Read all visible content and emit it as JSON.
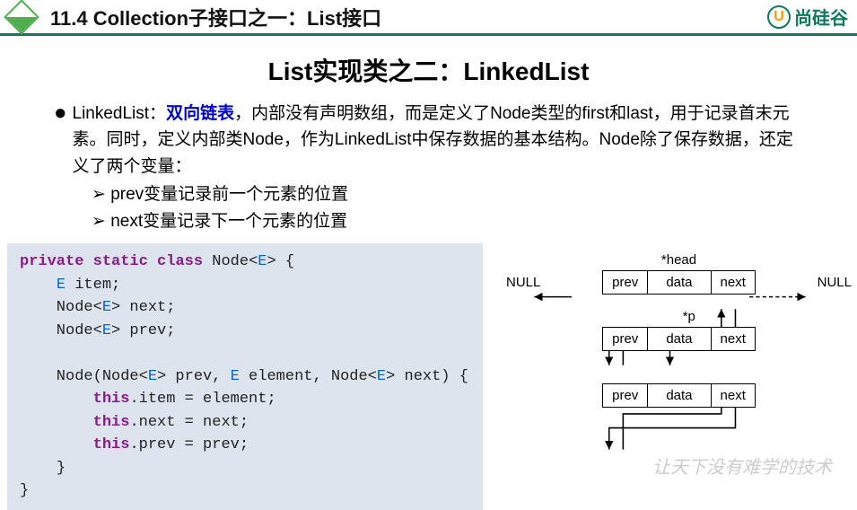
{
  "header": {
    "section": "11.4 Collection子接口之一：List接口",
    "brand_letter": "U",
    "brand_text": "尚硅谷"
  },
  "title2": "List实现类之二：LinkedList",
  "body": {
    "lead_name": "LinkedList：",
    "lead_emph": "双向链表",
    "lead_rest": "，内部没有声明数组，而是定义了Node类型的first和last，用于记录首末元素。同时，定义内部类Node，作为LinkedList中保存数据的基本结构。Node除了保存数据，还定义了两个变量：",
    "sub1": "prev变量记录前一个元素的位置",
    "sub2": "next变量记录下一个元素的位置"
  },
  "code": {
    "kw_private": "private",
    "kw_static": "static",
    "kw_class": "class",
    "cls_name": "Node",
    "gen_open": "<",
    "gen_E": "E",
    "gen_close": ">",
    "lbrace": " {",
    "item_decl_type": "E",
    "item_decl_name": " item;",
    "next_decl": "Node<",
    "next_decl2": "> next;",
    "prev_decl": "Node<",
    "prev_decl2": "> prev;",
    "ctor_sig1": "Node(Node<",
    "ctor_sig2": "> prev, ",
    "ctor_sig3": " element, Node<",
    "ctor_sig4": "> next) {",
    "this": "this",
    "assign_item": ".item = element;",
    "assign_next": ".next = next;",
    "assign_prev": ".prev = prev;",
    "rbrace": "}"
  },
  "diagram": {
    "head_label": "*head",
    "p_label": "*p",
    "null": "NULL",
    "prev": "prev",
    "data": "data",
    "next": "next"
  },
  "watermark": "让天下没有难学的技术"
}
